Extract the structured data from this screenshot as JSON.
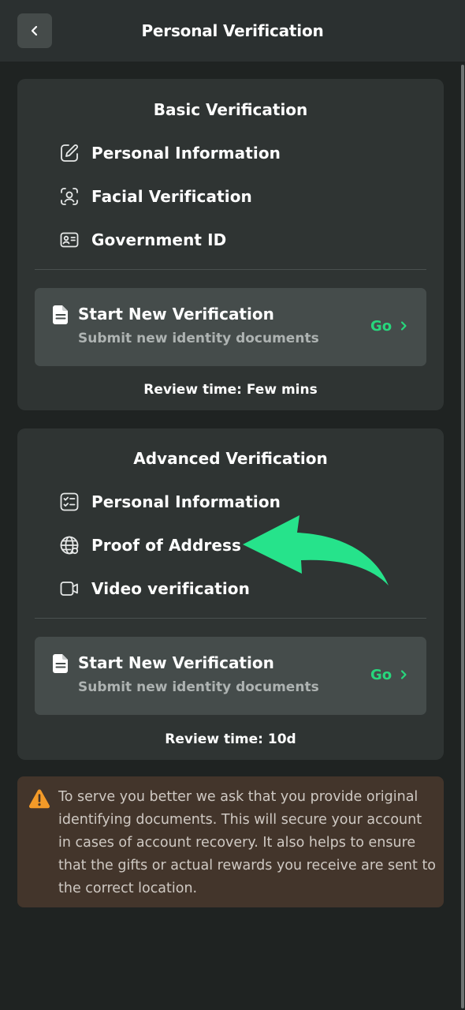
{
  "header": {
    "title": "Personal Verification",
    "back_icon": "chevron-left-icon"
  },
  "basic": {
    "title": "Basic Verification",
    "items": [
      {
        "label": "Personal Information",
        "icon": "edit-icon"
      },
      {
        "label": "Facial Verification",
        "icon": "face-scan-icon"
      },
      {
        "label": "Government ID",
        "icon": "id-card-icon"
      }
    ],
    "action": {
      "title": "Start New Verification",
      "subtitle": "Submit new identity documents",
      "go": "Go"
    },
    "review": "Review time: Few mins"
  },
  "advanced": {
    "title": "Advanced Verification",
    "items": [
      {
        "label": "Personal Information",
        "icon": "checklist-icon"
      },
      {
        "label": "Proof of Address",
        "icon": "globe-icon"
      },
      {
        "label": "Video verification",
        "icon": "video-camera-icon"
      }
    ],
    "action": {
      "title": "Start New Verification",
      "subtitle": "Submit new identity documents",
      "go": "Go"
    },
    "review": "Review time: 10d"
  },
  "notice": {
    "icon": "warning-icon",
    "text": "To serve you better we ask that you provide original identifying documents. This will secure your account in cases of account recovery. It also helps to ensure that the gifts or actual rewards you receive are sent to the correct location."
  },
  "colors": {
    "accent": "#27d77c",
    "warning": "#f39a28",
    "background": "#1f2322",
    "card": "#2f3433"
  }
}
